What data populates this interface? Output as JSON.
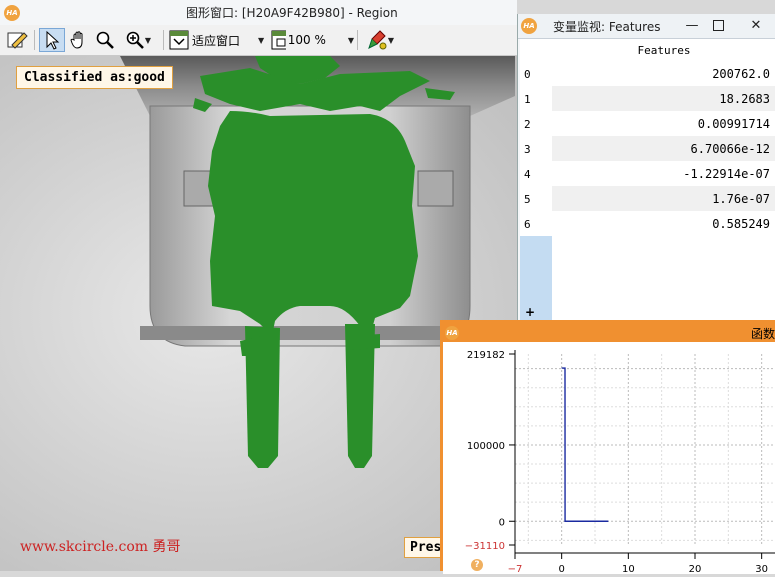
{
  "graphics_window": {
    "title": "图形窗口: [H20A9F42B980] - Region",
    "toolbar": {
      "zoom_mode": "适应窗口",
      "zoom_percent": "100 %"
    },
    "overlay_label": "Classified as:good",
    "bottom_label": "Pres",
    "watermark": "www.skcircle.com 勇哥"
  },
  "variable_window": {
    "title": "变量监视: Features",
    "column_header": "Features",
    "rows": [
      {
        "index": "0",
        "value": "200762.0"
      },
      {
        "index": "1",
        "value": "18.2683"
      },
      {
        "index": "2",
        "value": "0.00991714"
      },
      {
        "index": "3",
        "value": "6.70066e-12"
      },
      {
        "index": "4",
        "value": "-1.22914e-07"
      },
      {
        "index": "5",
        "value": "1.76e-07"
      },
      {
        "index": "6",
        "value": "0.585249"
      }
    ],
    "add_row": "+"
  },
  "function_window": {
    "title": "函数",
    "chart_data": {
      "type": "line",
      "y_ticks": [
        "219182",
        "100000",
        "0",
        "−31110"
      ],
      "x_ticks": [
        "−7",
        "0",
        "10",
        "20",
        "30"
      ],
      "xlim": [
        -7,
        32
      ],
      "ylim": [
        -31110,
        219182
      ],
      "series": [
        {
          "x": [
            0,
            0.01,
            0.5,
            0.51,
            7
          ],
          "y": [
            200762,
            200762,
            200762,
            0,
            0
          ]
        }
      ],
      "grid": true,
      "line_color": "#1a2aa0"
    }
  },
  "colors": {
    "region": "#2a8f2a",
    "accent": "#f09030"
  }
}
